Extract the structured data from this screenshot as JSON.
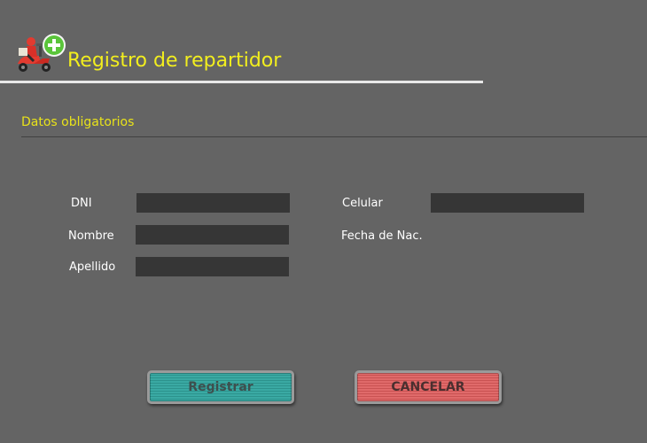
{
  "header": {
    "title": "Registro de repartidor",
    "logo_icon": "delivery-scooter-add-icon"
  },
  "section": {
    "title": "Datos obligatorios"
  },
  "form": {
    "dni_label": "DNI",
    "dni_value": "",
    "nombre_label": "Nombre",
    "nombre_value": "",
    "apellido_label": "Apellido",
    "apellido_value": "",
    "celular_label": "Celular",
    "celular_value": "",
    "fecha_nac_label": "Fecha de Nac."
  },
  "actions": {
    "register_label": "Registrar",
    "cancel_label": "CANCELAR"
  },
  "colors": {
    "background": "#646464",
    "title": "#f2ee1e",
    "field": "#363636",
    "register": "#3aa9a3",
    "cancel": "#e06a6a"
  }
}
